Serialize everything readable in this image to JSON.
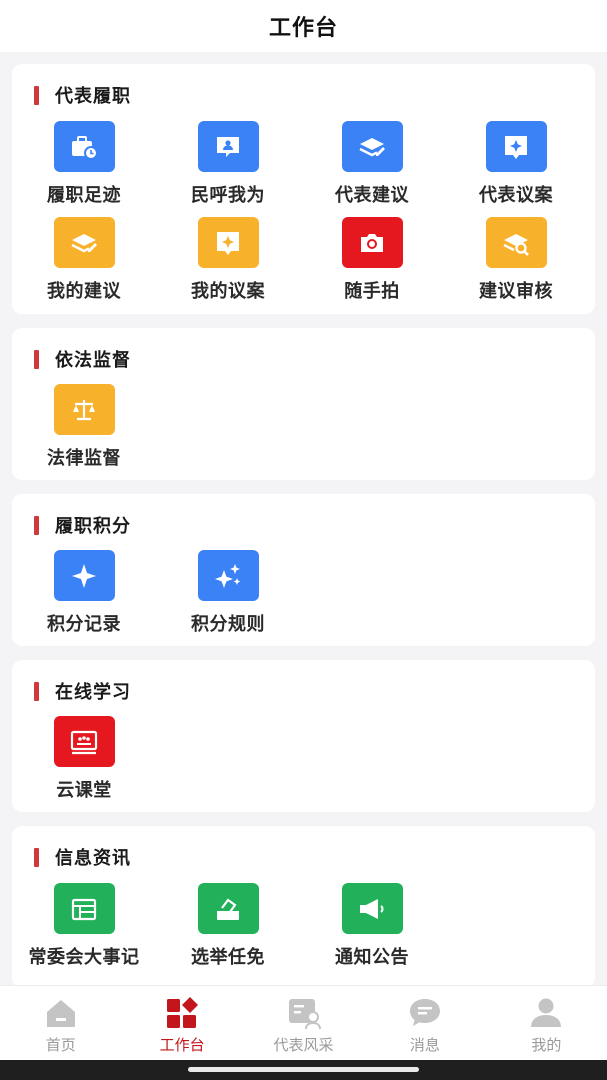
{
  "header": {
    "title": "工作台"
  },
  "sections": [
    {
      "title": "代表履职",
      "items": [
        {
          "label": "履职足迹",
          "icon": "briefcase-clock-icon",
          "color": "#3b82f6"
        },
        {
          "label": "民呼我为",
          "icon": "chat-person-icon",
          "color": "#3b82f6"
        },
        {
          "label": "代表建议",
          "icon": "layers-edit-icon",
          "color": "#3b82f6"
        },
        {
          "label": "代表议案",
          "icon": "sparkle-message-icon",
          "color": "#3b82f6"
        },
        {
          "label": "我的建议",
          "icon": "layers-edit-icon",
          "color": "#f7b12b"
        },
        {
          "label": "我的议案",
          "icon": "sparkle-message-icon",
          "color": "#f7b12b"
        },
        {
          "label": "随手拍",
          "icon": "camera-icon",
          "color": "#e5171f"
        },
        {
          "label": "建议审核",
          "icon": "layers-search-icon",
          "color": "#f7b12b"
        }
      ]
    },
    {
      "title": "依法监督",
      "items": [
        {
          "label": "法律监督",
          "icon": "scales-icon",
          "color": "#f7b12b"
        }
      ]
    },
    {
      "title": "履职积分",
      "items": [
        {
          "label": "积分记录",
          "icon": "sparkle-icon",
          "color": "#3b82f6"
        },
        {
          "label": "积分规则",
          "icon": "sparkles-icon",
          "color": "#3b82f6"
        }
      ]
    },
    {
      "title": "在线学习",
      "items": [
        {
          "label": "云课堂",
          "icon": "classroom-icon",
          "color": "#e5171f"
        }
      ]
    },
    {
      "title": "信息资讯",
      "items": [
        {
          "label": "常委会大事记",
          "icon": "calendar-icon",
          "color": "#22b15a"
        },
        {
          "label": "选举任免",
          "icon": "ballot-icon",
          "color": "#22b15a"
        },
        {
          "label": "通知公告",
          "icon": "megaphone-icon",
          "color": "#22b15a"
        }
      ]
    }
  ],
  "tabs": [
    {
      "label": "首页",
      "icon": "home-icon",
      "active": false
    },
    {
      "label": "工作台",
      "icon": "workbench-icon",
      "active": true
    },
    {
      "label": "代表风采",
      "icon": "profile-card-icon",
      "active": false
    },
    {
      "label": "消息",
      "icon": "message-icon",
      "active": false
    },
    {
      "label": "我的",
      "icon": "user-icon",
      "active": false
    }
  ],
  "colors": {
    "accent": "#c3161c",
    "section_bar": "#d0393b"
  }
}
